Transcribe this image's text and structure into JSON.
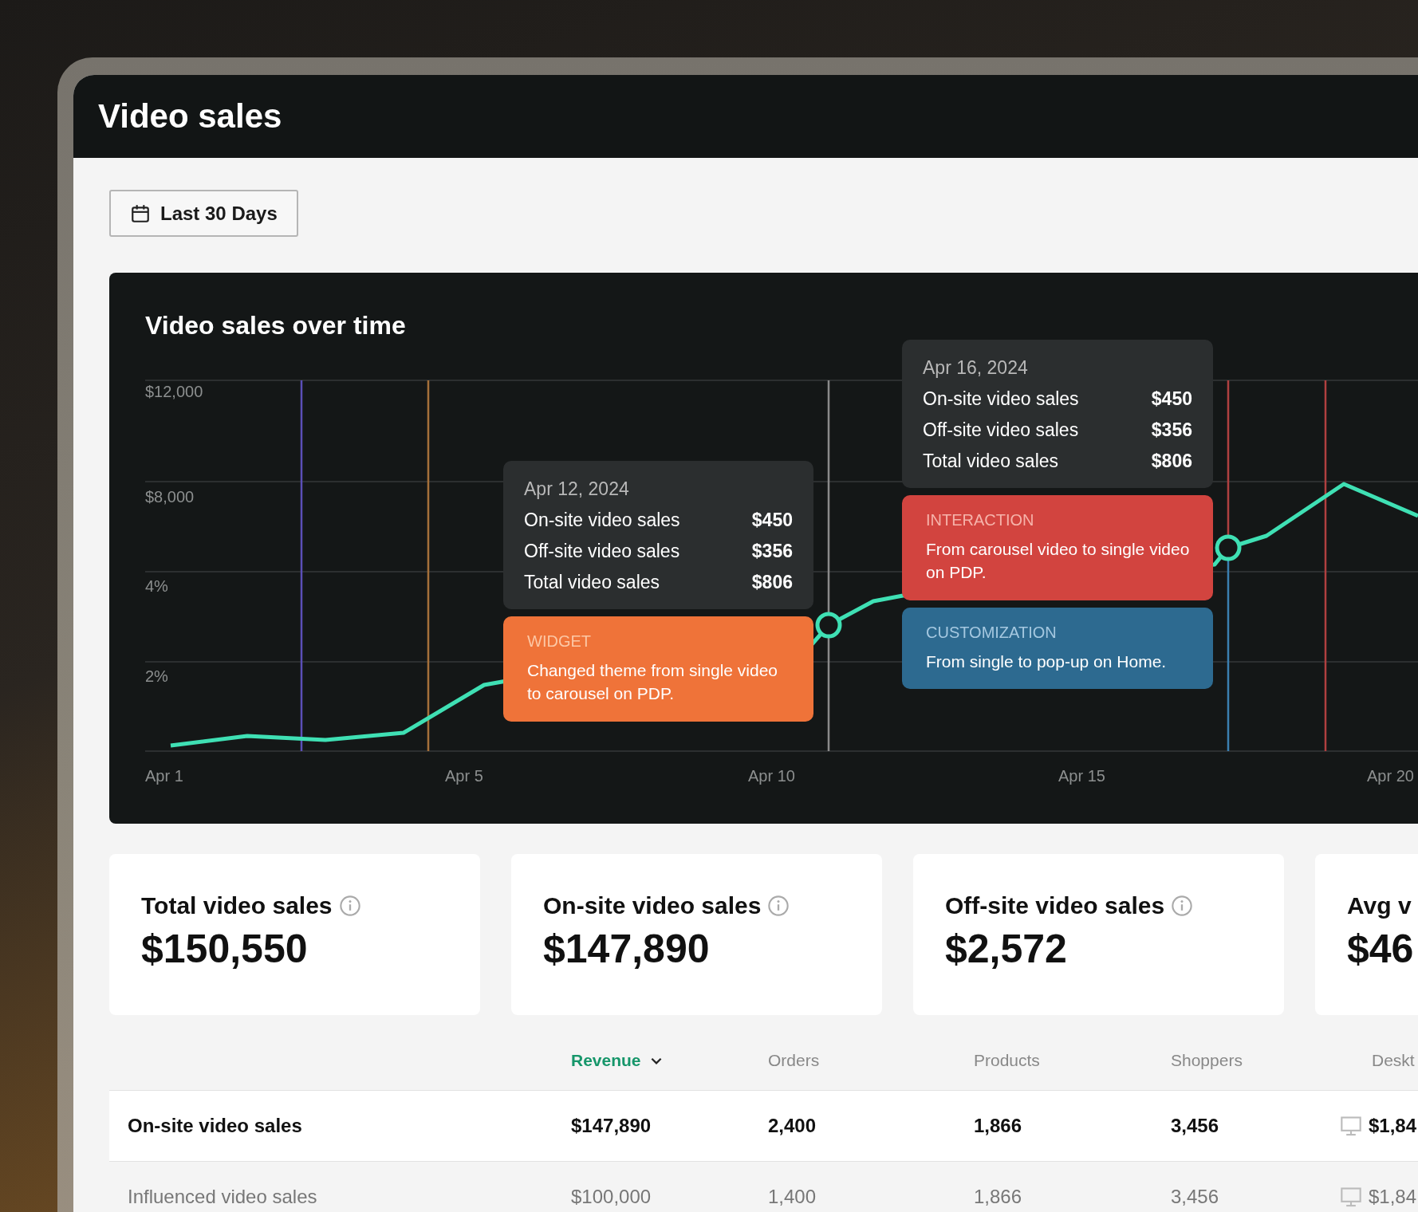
{
  "header": {
    "title": "Video sales"
  },
  "date_range": {
    "label": "Last 30 Days"
  },
  "chart": {
    "title": "Video sales over time",
    "y_axis_labels": [
      "$12,000",
      "$8,000",
      "4%",
      "2%"
    ],
    "x_axis_labels": [
      "Apr 1",
      "Apr 5",
      "Apr 10",
      "Apr 15",
      "Apr 20"
    ],
    "markers": [
      {
        "tooltip": {
          "date": "Apr 12, 2024",
          "rows": [
            {
              "label": "On-site video sales",
              "value": "$450"
            },
            {
              "label": "Off-site video sales",
              "value": "$356"
            },
            {
              "label": "Total video sales",
              "value": "$806"
            }
          ]
        },
        "annotations": [
          {
            "kind": "widget",
            "label": "WIDGET",
            "text": "Changed theme from single video to carousel on PDP.",
            "color": "#ef7339"
          }
        ]
      },
      {
        "tooltip": {
          "date": "Apr 16, 2024",
          "rows": [
            {
              "label": "On-site video sales",
              "value": "$450"
            },
            {
              "label": "Off-site video sales",
              "value": "$356"
            },
            {
              "label": "Total video sales",
              "value": "$806"
            }
          ]
        },
        "annotations": [
          {
            "kind": "interaction",
            "label": "INTERACTION",
            "text": "From carousel video to single video on PDP.",
            "color": "#d2443f"
          },
          {
            "kind": "customization",
            "label": "CUSTOMIZATION",
            "text": "From single to pop-up on Home.",
            "color": "#2d6a90"
          }
        ]
      }
    ]
  },
  "stats": [
    {
      "title": "Total video sales",
      "value": "$150,550"
    },
    {
      "title": "On-site video sales",
      "value": "$147,890"
    },
    {
      "title": "Off-site video sales",
      "value": "$2,572"
    },
    {
      "title": "Avg v",
      "value": "$46"
    }
  ],
  "table": {
    "columns": [
      {
        "label": "Revenue",
        "kind": "metric",
        "sorted": true
      },
      {
        "label": "Orders",
        "kind": "metric",
        "sorted": false
      },
      {
        "label": "Products",
        "kind": "metric",
        "sorted": false
      },
      {
        "label": "Shoppers",
        "kind": "metric",
        "sorted": false
      },
      {
        "label": "Deskt",
        "kind": "device",
        "sorted": false
      }
    ],
    "rows": [
      {
        "kind": "primary",
        "label": "On-site video sales",
        "cells": [
          "$147,890",
          "2,400",
          "1,866",
          "3,456",
          "$1,84"
        ]
      },
      {
        "kind": "secondary",
        "label": "Influenced video sales",
        "cells": [
          "$100,000",
          "1,400",
          "1,866",
          "3,456",
          "$1,84"
        ]
      }
    ]
  }
}
